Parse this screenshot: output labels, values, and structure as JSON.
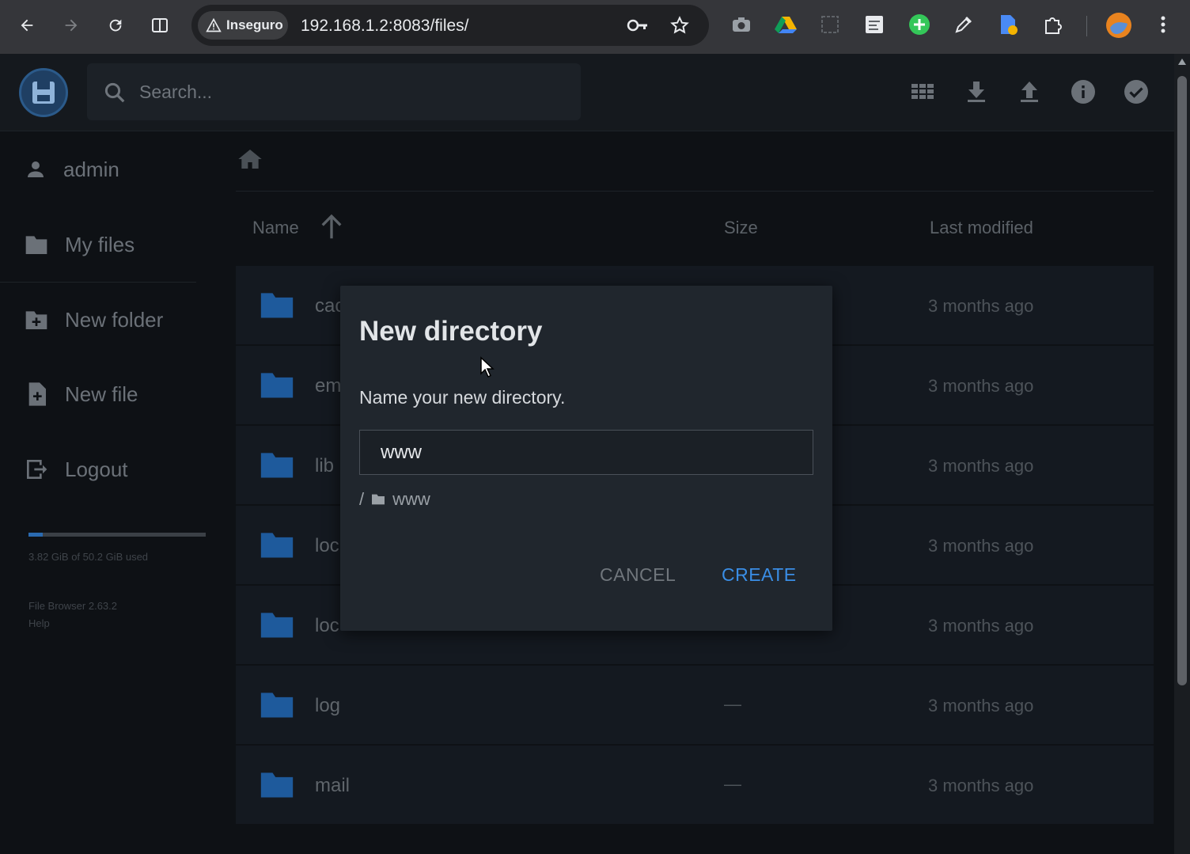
{
  "browser": {
    "security_label": "Inseguro",
    "url": "192.168.1.2:8083/files/"
  },
  "app": {
    "search_placeholder": "Search...",
    "accent_color": "#3a8ee6"
  },
  "sidebar": {
    "user": "admin",
    "items": [
      {
        "label": "My files",
        "icon": "folder-icon"
      },
      {
        "label": "New folder",
        "icon": "new-folder-icon"
      },
      {
        "label": "New file",
        "icon": "new-file-icon"
      },
      {
        "label": "Logout",
        "icon": "logout-icon"
      }
    ],
    "usage_text": "3.82 GiB of 50.2 GiB used",
    "usage_fraction": 0.08,
    "version": "File Browser 2.63.2",
    "help": "Help"
  },
  "table": {
    "headers": {
      "name": "Name",
      "size": "Size",
      "modified": "Last modified"
    },
    "rows": [
      {
        "name": "cac",
        "size": "",
        "modified": "3 months ago"
      },
      {
        "name": "em",
        "size": "",
        "modified": "3 months ago"
      },
      {
        "name": "lib",
        "size": "",
        "modified": "3 months ago"
      },
      {
        "name": "loc",
        "size": "",
        "modified": "3 months ago"
      },
      {
        "name": "loc",
        "size": "",
        "modified": "3 months ago"
      },
      {
        "name": "log",
        "size": "—",
        "modified": "3 months ago"
      },
      {
        "name": "mail",
        "size": "—",
        "modified": "3 months ago"
      }
    ]
  },
  "modal": {
    "title": "New directory",
    "description": "Name your new directory.",
    "input_value": "www",
    "path_root": "/",
    "path_name": "www",
    "cancel_label": "CANCEL",
    "create_label": "CREATE"
  }
}
